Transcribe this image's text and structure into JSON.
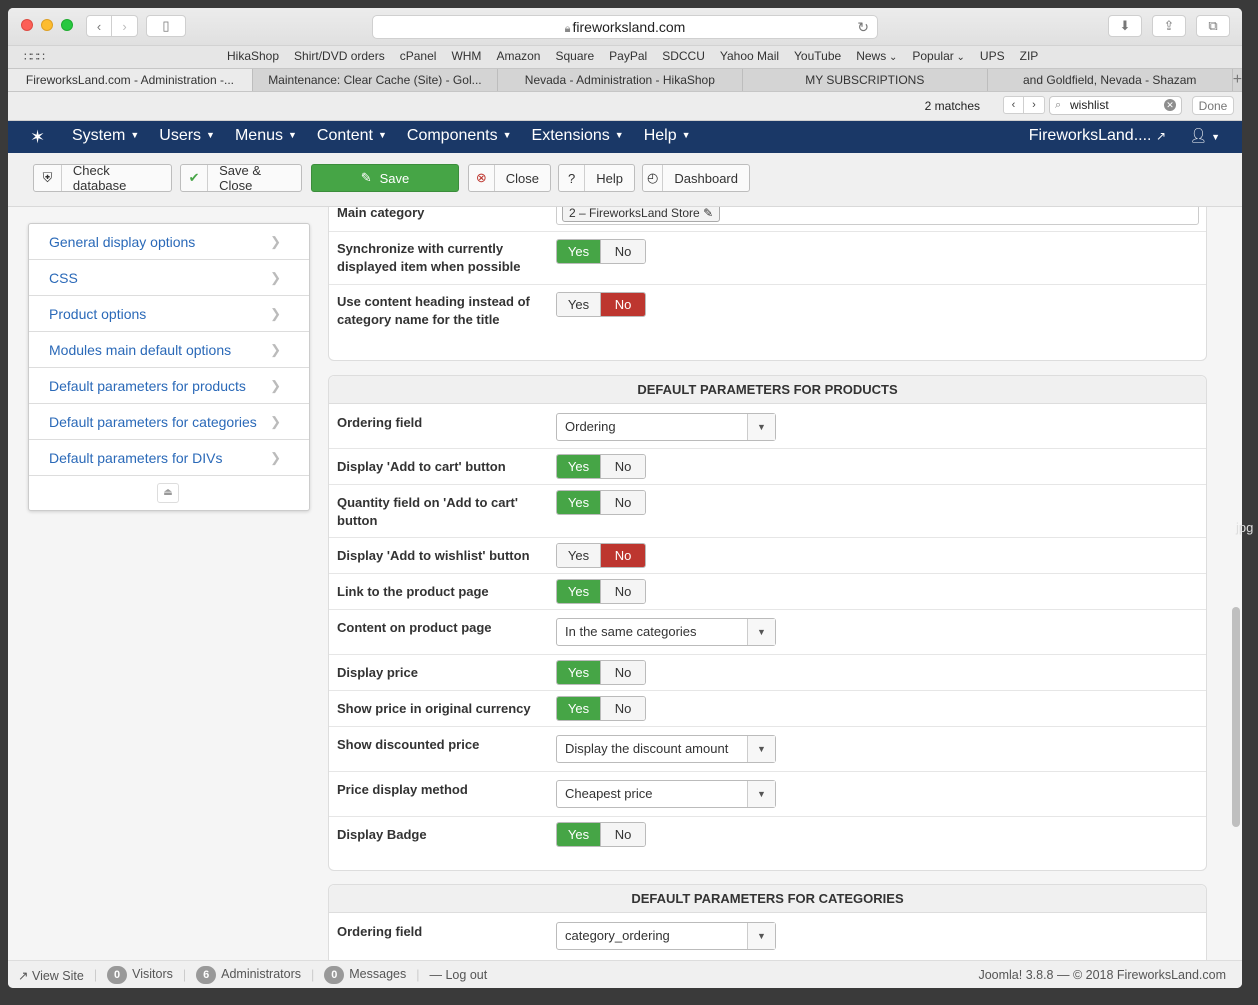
{
  "browser": {
    "url": "fireworksland.com",
    "favorites": [
      "HikaShop",
      "Shirt/DVD orders",
      "cPanel",
      "WHM",
      "Amazon",
      "Square",
      "PayPal",
      "SDCCU",
      "Yahoo Mail",
      "YouTube",
      "News",
      "Popular",
      "UPS",
      "ZIP"
    ],
    "tabs": [
      "FireworksLand.com - Administration -...",
      "Maintenance: Clear Cache (Site) - Gol...",
      "Nevada - Administration - HikaShop",
      "MY SUBSCRIPTIONS",
      "and Goldfield, Nevada - Shazam"
    ],
    "find": {
      "matches": "2 matches",
      "query": "wishlist",
      "done_label": "Done"
    }
  },
  "joomla_nav": {
    "menu": [
      "System",
      "Users",
      "Menus",
      "Content",
      "Components",
      "Extensions",
      "Help"
    ],
    "site_name": "FireworksLand...."
  },
  "toolbar": {
    "check_db": "Check database",
    "save_close": "Save & Close",
    "save": "Save",
    "close": "Close",
    "help": "Help",
    "dashboard": "Dashboard"
  },
  "sidebar": {
    "items": [
      "General display options",
      "CSS",
      "Product options",
      "Modules main default options",
      "Default parameters for products",
      "Default parameters for categories",
      "Default parameters for DIVs"
    ]
  },
  "top_panel": {
    "main_category_label": "Main category",
    "main_category_value": "2 – FireworksLand Store",
    "sync_label": "Synchronize with currently displayed item when possible",
    "heading_label": "Use content heading instead of category name for the title"
  },
  "yes_no": {
    "yes": "Yes",
    "no": "No"
  },
  "products_panel": {
    "title": "DEFAULT PARAMETERS FOR PRODUCTS",
    "ordering_label": "Ordering field",
    "ordering_value": "Ordering",
    "add_to_cart_label": "Display 'Add to cart' button",
    "quantity_label": "Quantity field on 'Add to cart' button",
    "wishlist_label": "Display 'Add to wishlist' button",
    "link_label": "Link to the product page",
    "content_label": "Content on product page",
    "content_value": "In the same categories",
    "price_label": "Display price",
    "orig_currency_label": "Show price in original currency",
    "discount_label": "Show discounted price",
    "discount_value": "Display the discount amount",
    "method_label": "Price display method",
    "method_value": "Cheapest price",
    "badge_label": "Display Badge"
  },
  "categories_panel": {
    "title": "DEFAULT PARAMETERS FOR CATEGORIES",
    "ordering_label": "Ordering field",
    "ordering_value": "category_ordering"
  },
  "statusbar": {
    "view_site": "View Site",
    "visitors_count": "0",
    "visitors": "Visitors",
    "admins_count": "6",
    "admins": "Administrators",
    "messages_count": "0",
    "messages": "Messages",
    "logout": "Log out",
    "version": "Joomla! 3.8.8  —  © 2018 FireworksLand.com"
  },
  "edge_text": "jpg",
  "colors": {
    "joomla_nav": "#1a3867",
    "yes_green": "#46a546",
    "no_red": "#bd362f",
    "link_blue": "#2a69b8"
  }
}
